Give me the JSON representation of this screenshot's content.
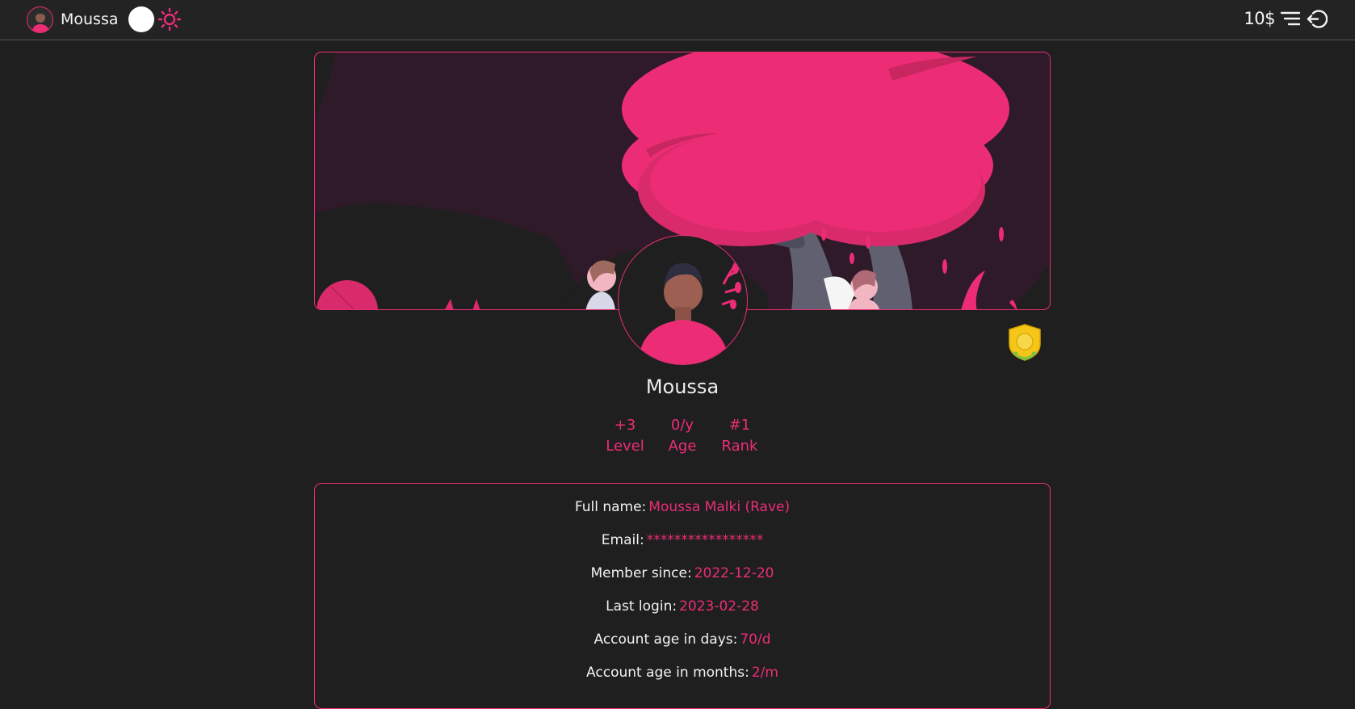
{
  "header": {
    "username": "Moussa",
    "balance": "10$",
    "icons": [
      "avatar-icon",
      "theme-toggle",
      "sun-icon",
      "menu-icon",
      "logout-icon"
    ]
  },
  "profile": {
    "name": "Moussa",
    "stats": [
      {
        "value": "+3",
        "label": "Level"
      },
      {
        "value": "0/y",
        "label": "Age"
      },
      {
        "value": "#1",
        "label": "Rank"
      }
    ]
  },
  "details": [
    {
      "label": "Full name:",
      "value": "Moussa Malki (Rave)"
    },
    {
      "label": "Email:",
      "value": "*****************"
    },
    {
      "label": "Member since:",
      "value": "2022-12-20"
    },
    {
      "label": "Last login:",
      "value": "2023-02-28"
    },
    {
      "label": "Account age in days:",
      "value": "70/d"
    },
    {
      "label": "Account age in months:",
      "value": "2/m"
    }
  ],
  "colors": {
    "accent": "#ec2d76",
    "background": "#1f1f1f",
    "topbar": "#232323"
  }
}
